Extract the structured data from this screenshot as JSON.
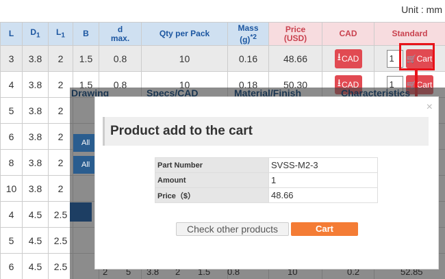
{
  "unit_label": "Unit : mm",
  "table": {
    "headers": [
      "L",
      "D1",
      "L1",
      "B",
      "d max.",
      "Qty per Pack",
      "Mass (g)*2",
      "Price (USD)",
      "CAD",
      "Standard"
    ],
    "header_parts": {
      "d_line1": "d",
      "d_line2": "max.",
      "mass_line1": "Mass",
      "mass_line2": "(g)",
      "mass_sup": "*2",
      "price_line1": "Price",
      "price_line2": "(USD)",
      "D_main": "D",
      "D_sub": "1",
      "L1_main": "L",
      "L1_sub": "1"
    },
    "rows": [
      {
        "L": "3",
        "D1": "3.8",
        "L1": "2",
        "B": "1.5",
        "d": "0.8",
        "qty": "10",
        "mass": "0.16",
        "price": "48.66",
        "cad": "CAD",
        "qty_input": "1",
        "cart": "Cart"
      },
      {
        "L": "4",
        "D1": "3.8",
        "L1": "2",
        "B": "1.5",
        "d": "0.8",
        "qty": "10",
        "mass": "0.18",
        "price": "50.30",
        "cad": "CAD",
        "qty_input": "1",
        "cart": "Cart"
      },
      {
        "L": "5",
        "D1": "3.8",
        "L1": "2"
      },
      {
        "L": "6",
        "D1": "3.8",
        "L1": "2"
      },
      {
        "L": "8",
        "D1": "3.8",
        "L1": "2"
      },
      {
        "L": "10",
        "D1": "3.8",
        "L1": "2"
      },
      {
        "L": "4",
        "D1": "4.5",
        "L1": "2.5"
      },
      {
        "L": "5",
        "D1": "4.5",
        "L1": "2.5"
      },
      {
        "L": "6",
        "D1": "4.5",
        "L1": "2.5"
      }
    ]
  },
  "background_tabs": [
    "Drawing",
    "Specs/CAD",
    "Material/Finish",
    "Characteristics"
  ],
  "background_filter_label": "All",
  "background_bottom_row": [
    "2",
    "5",
    "3.8",
    "2",
    "1.5",
    "0.8",
    "10",
    "0.2",
    "52.85"
  ],
  "modal": {
    "title": "Product add to the cart",
    "close": "×",
    "rows": [
      {
        "label": "Part Number",
        "value": "SVSS-M2-3"
      },
      {
        "label": "Amount",
        "value": "1"
      },
      {
        "label": "Price（$）",
        "value": "48.66"
      }
    ],
    "check_other_label": "Check other products",
    "cart_label": "Cart"
  },
  "colors": {
    "header_blue": "#cfe0f1",
    "header_pink": "#f7dcdf",
    "button_red": "#e14a52",
    "highlight_red": "#e8131a",
    "cart_orange": "#f47c35"
  }
}
